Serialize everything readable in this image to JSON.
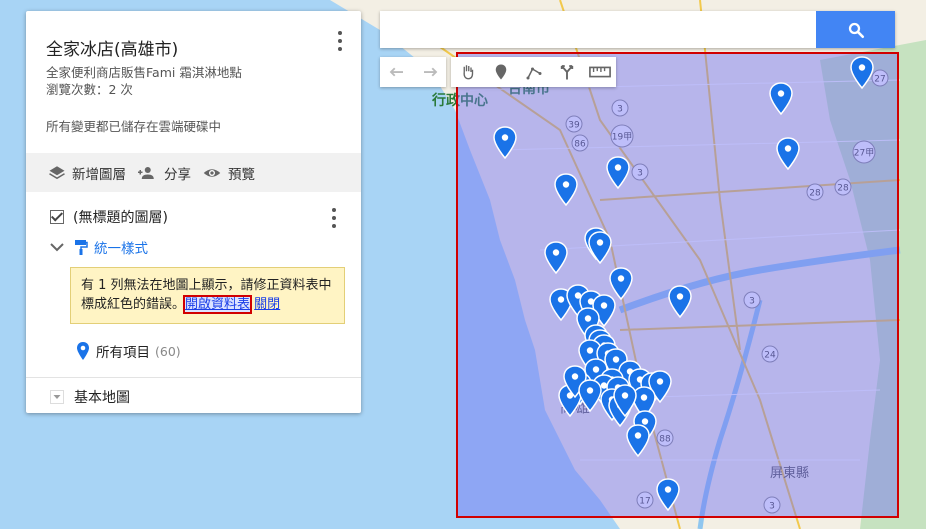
{
  "map_title": "全家冰店(高雄市)",
  "map_description": "全家便利商店販售Fami 霜淇淋地點",
  "view_count": "瀏覽次數：2 次",
  "save_status": "所有變更都已儲存在雲端硬碟中",
  "toolbar": {
    "add_layer": "新增圖層",
    "share": "分享",
    "preview": "預覽"
  },
  "layer": {
    "name": "(無標題的圖層)",
    "style": "統一樣式",
    "warning_text": "有 1 列無法在地圖上顯示，請修正資料表中標成紅色的錯誤。",
    "open_table": "開啟資料表",
    "close": "關閉",
    "all_items": "所有項目",
    "item_count": "(60)"
  },
  "base_map": "基本地圖",
  "search": {
    "placeholder": ""
  },
  "map_labels": {
    "district_top": "行政中心",
    "district_top2": "台南市",
    "county": "屏東縣",
    "city_fragment": "高雄"
  },
  "route_shields": [
    "27",
    "3",
    "39",
    "86",
    "19甲",
    "3",
    "27甲",
    "28",
    "28",
    "3",
    "24",
    "88",
    "17",
    "3"
  ],
  "colors": {
    "accent": "#1a73e8",
    "search_button": "#4285f4",
    "marker": "#1a73e8",
    "selection_border": "#d10000",
    "selection_fill": "#6e6ef5",
    "warning_bg": "#fff4c4"
  },
  "icons": {
    "layers": "layers-icon",
    "share": "person-add-icon",
    "preview": "eye-icon",
    "search": "search-icon",
    "undo": "undo-icon",
    "redo": "redo-icon",
    "pan": "hand-icon",
    "marker": "marker-icon",
    "line": "draw-line-icon",
    "route": "route-icon",
    "measure": "ruler-icon"
  }
}
